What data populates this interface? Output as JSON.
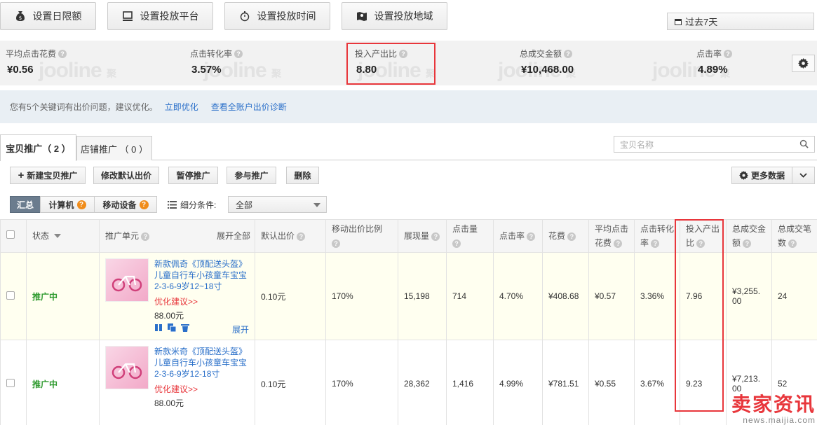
{
  "top_buttons": [
    {
      "label": "设置日限额",
      "icon": "money-bag-icon"
    },
    {
      "label": "设置投放平台",
      "icon": "monitor-icon"
    },
    {
      "label": "设置投放时间",
      "icon": "stopwatch-icon"
    },
    {
      "label": "设置投放地域",
      "icon": "map-pin-icon"
    }
  ],
  "date_range": "过去7天",
  "stats": [
    {
      "label": "平均点击花费",
      "value": "¥0.56"
    },
    {
      "label": "点击转化率",
      "value": "3.57%"
    },
    {
      "label": "投入产出比",
      "value": "8.80"
    },
    {
      "label": "总成交金额",
      "value": "¥10,468.00"
    },
    {
      "label": "点击率",
      "value": "4.89%"
    }
  ],
  "watermark": {
    "latin": "jooline",
    "cjk1": "聚",
    "cjk2": "连"
  },
  "notice": {
    "text": "您有5个关键词有出价问题，建议优化。",
    "link1": "立即优化",
    "link2": "查看全账户出价诊断"
  },
  "tabs": [
    {
      "label": "宝贝推广（ 2 ）",
      "active": true
    },
    {
      "label": "店铺推广 （ 0 ）",
      "active": false
    }
  ],
  "search": {
    "placeholder": "宝贝名称"
  },
  "actions": {
    "new": "新建宝贝推广",
    "edit_bid": "修改默认出价",
    "pause": "暂停推广",
    "join": "参与推广",
    "delete": "删除",
    "more": "更多数据"
  },
  "segments": {
    "summary": "汇总",
    "computer": "计算机",
    "mobile": "移动设备",
    "badge": "?"
  },
  "filter": {
    "label": "细分条件:",
    "value": "全部"
  },
  "columns": {
    "status": "状态",
    "unit": "推广单元",
    "expand_all": "展开全部",
    "default_bid": "默认出价",
    "mobile_ratio": "移动出价比例",
    "impressions": "展现量",
    "clicks": "点击量",
    "ctr": "点击率",
    "cost": "花费",
    "avg_cpc_1": "平均点击",
    "avg_cpc_2": "花费",
    "cvr_1": "点击转化",
    "cvr_2": "率",
    "roi_1": "投入产出",
    "roi_2": "比",
    "gmv_1": "总成交金",
    "gmv_2": "额",
    "orders_1": "总成交笔",
    "orders_2": "数"
  },
  "rows": [
    {
      "status": "推广中",
      "title": "新款佩奇《顶配送头盔》儿童自行车小孩童车宝宝2-3-6-9岁12~18寸",
      "opt": "优化建议>>",
      "price": "88.00元",
      "expand": "展开",
      "default_bid": "0.10元",
      "mobile_ratio": "170%",
      "impressions": "15,198",
      "clicks": "714",
      "ctr": "4.70%",
      "cost": "¥408.68",
      "avg_cpc": "¥0.57",
      "cvr": "3.36%",
      "roi": "7.96",
      "gmv_1": "¥3,255.",
      "gmv_2": "00",
      "orders": "24"
    },
    {
      "status": "推广中",
      "title": "新款米奇《顶配送头盔》儿童自行车小孩童车宝宝2-3-6-9岁12-18寸",
      "opt": "优化建议>>",
      "price": "88.00元",
      "expand": "",
      "default_bid": "0.10元",
      "mobile_ratio": "170%",
      "impressions": "28,362",
      "clicks": "1,416",
      "ctr": "4.99%",
      "cost": "¥781.51",
      "avg_cpc": "¥0.55",
      "cvr": "3.67%",
      "roi": "9.23",
      "gmv_1": "¥7,213.",
      "gmv_2": "00",
      "orders": "52"
    }
  ],
  "brand": {
    "name": "卖家资讯",
    "url": "news.maijia.com"
  },
  "colors": {
    "accent_red": "#e8363b",
    "link_blue": "#2a6fc9",
    "status_green": "#2e9a2e",
    "badge_orange": "#f08c1a"
  }
}
